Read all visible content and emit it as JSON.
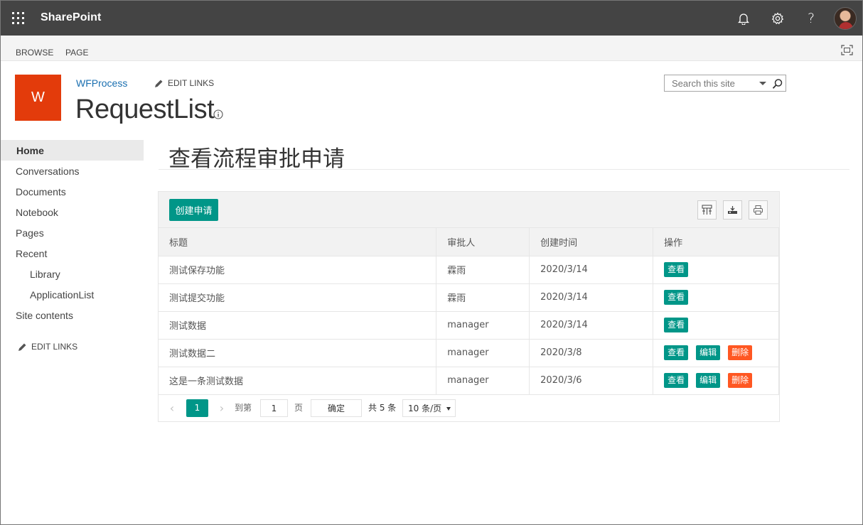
{
  "suitebar": {
    "brand": "SharePoint",
    "icons": [
      "bell-icon",
      "gear-icon",
      "help-icon"
    ],
    "help_glyph": "?"
  },
  "ribbon": {
    "tabs": [
      "BROWSE",
      "PAGE"
    ]
  },
  "site": {
    "logo_letter": "W",
    "site_name": "WFProcess",
    "edit_links": "EDIT LINKS",
    "page_title": "RequestList",
    "search_placeholder": "Search this site"
  },
  "leftnav": {
    "items": [
      {
        "label": "Home",
        "selected": true,
        "indent": 0
      },
      {
        "label": "Conversations",
        "indent": 0
      },
      {
        "label": "Documents",
        "indent": 0
      },
      {
        "label": "Notebook",
        "indent": 0
      },
      {
        "label": "Pages",
        "indent": 0
      },
      {
        "label": "Recent",
        "indent": 0
      },
      {
        "label": "Library",
        "indent": 1
      },
      {
        "label": "ApplicationList",
        "indent": 1
      },
      {
        "label": "Site contents",
        "indent": 0
      }
    ],
    "edit_links": "EDIT LINKS"
  },
  "content": {
    "title": "查看流程审批申请",
    "create_button": "创建申请",
    "tool_icons": [
      "columns-filter-icon",
      "export-icon",
      "print-icon"
    ],
    "columns": [
      "标题",
      "审批人",
      "创建时间",
      "操作"
    ],
    "rows": [
      {
        "title": "测试保存功能",
        "approver": "霖雨",
        "created": "2020/3/14",
        "actions": [
          "查看"
        ]
      },
      {
        "title": "测试提交功能",
        "approver": "霖雨",
        "created": "2020/3/14",
        "actions": [
          "查看"
        ]
      },
      {
        "title": "测试数据",
        "approver": "manager",
        "created": "2020/3/14",
        "actions": [
          "查看"
        ]
      },
      {
        "title": "测试数据二",
        "approver": "manager",
        "created": "2020/3/8",
        "actions": [
          "查看",
          "编辑",
          "删除"
        ]
      },
      {
        "title": "这是一条测试数据",
        "approver": "manager",
        "created": "2020/3/6",
        "actions": [
          "查看",
          "编辑",
          "删除"
        ]
      }
    ],
    "action_colors": {
      "查看": "#009688",
      "编辑": "#009688",
      "删除": "#ff5722"
    }
  },
  "pager": {
    "current_page": "1",
    "goto_label": "到第",
    "page_input": "1",
    "page_unit": "页",
    "confirm": "确定",
    "total": "共 5 条",
    "page_size": "10 条/页",
    "prev": "‹",
    "next": "›"
  },
  "colors": {
    "suitebar": "#444444",
    "accent": "#009688",
    "danger": "#ff5722",
    "logo": "#e33b0b",
    "link": "#1a6fb0"
  }
}
